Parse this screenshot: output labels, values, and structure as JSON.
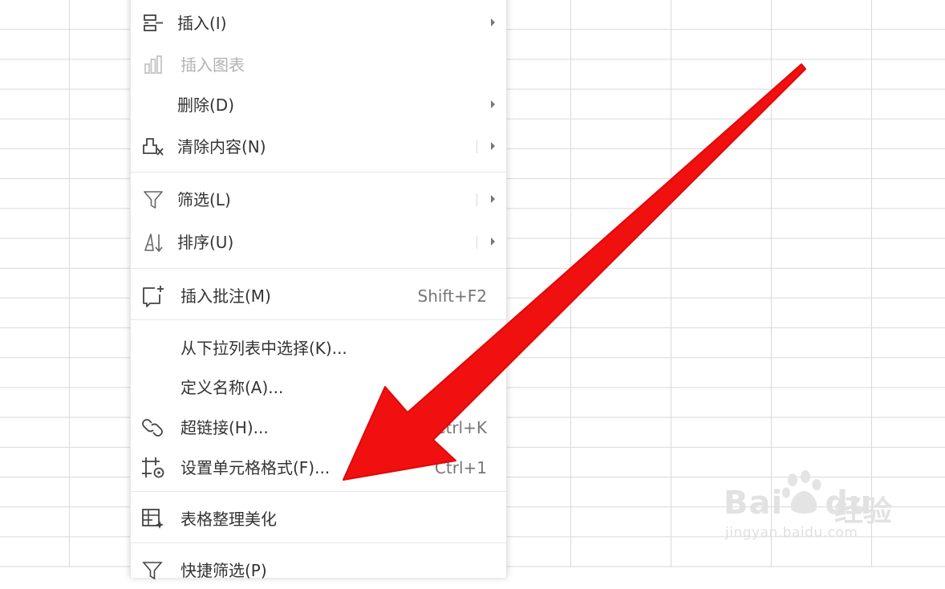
{
  "menu": {
    "items": [
      {
        "label": "插入(I)",
        "icon": "insert-row-icon",
        "submenu": true,
        "disabled": false
      },
      {
        "label": "插入图表",
        "icon": "bar-chart-icon",
        "submenu": false,
        "disabled": true
      },
      {
        "label": "删除(D)",
        "icon": "",
        "submenu": true,
        "disabled": false
      },
      {
        "label": "清除内容(N)",
        "icon": "eraser-icon",
        "submenu": true,
        "disabled": false
      },
      {
        "label": "筛选(L)",
        "icon": "filter-icon",
        "submenu": true,
        "disabled": false
      },
      {
        "label": "排序(U)",
        "icon": "sort-icon",
        "submenu": true,
        "disabled": false
      },
      {
        "label": "插入批注(M)",
        "icon": "comment-add-icon",
        "shortcut": "Shift+F2"
      },
      {
        "label": "从下拉列表中选择(K)...",
        "icon": ""
      },
      {
        "label": "定义名称(A)...",
        "icon": ""
      },
      {
        "label": "超链接(H)...",
        "icon": "link-icon",
        "shortcut": "Ctrl+K"
      },
      {
        "label": "设置单元格格式(F)...",
        "icon": "cell-format-icon",
        "shortcut": "Ctrl+1"
      },
      {
        "label": "表格整理美化",
        "icon": "table-beautify-icon"
      },
      {
        "label": "快捷筛选(P)",
        "icon": "quick-filter-icon"
      }
    ]
  },
  "watermark": {
    "brand": "Bai",
    "brand_suffix": "du",
    "cn": "经验",
    "url": "jingyan.baidu.com"
  },
  "colors": {
    "arrow": "#f01010",
    "grid": "#d6d9dc",
    "menu_text": "#333333",
    "disabled_text": "#b3b3b3"
  }
}
